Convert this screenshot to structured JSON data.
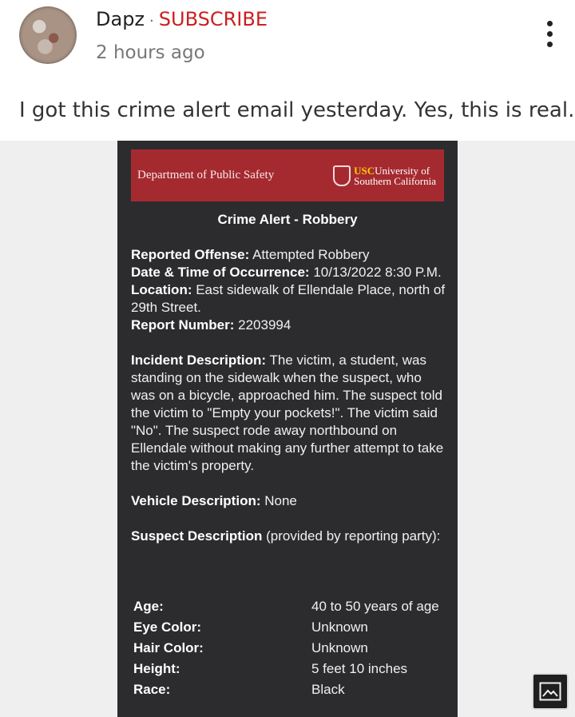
{
  "post": {
    "author": "Dapz",
    "separator": "·",
    "subscribe_label": "SUBSCRIBE",
    "timestamp": "2 hours ago",
    "text": "I got this crime alert email yesterday. Yes, this is real."
  },
  "email": {
    "banner_title": "Department of Public Safety",
    "logo_usc": "USC",
    "logo_line1": "University of",
    "logo_line2": "Southern California",
    "alert_title": "Crime Alert - Robbery",
    "fields": {
      "offense_label": "Reported Offense:",
      "offense_value": " Attempted Robbery",
      "datetime_label": "Date & Time of Occurrence:",
      "datetime_value": " 10/13/2022 8:30 P.M.",
      "location_label": "Location:",
      "location_value": " East sidewalk of Ellendale Place, north of 29th Street.",
      "report_label": "Report Number:",
      "report_value": " 2203994"
    },
    "incident_label": "Incident Description:",
    "incident_value": " The victim, a student, was standing on the sidewalk when the suspect, who was on a bicycle, approached him. The suspect told the victim to \"Empty your pockets!\". The victim said \"No\". The suspect rode away northbound on Ellendale without making any further attempt to take the victim's property.",
    "vehicle_label": "Vehicle Description:",
    "vehicle_value": " None",
    "suspect_label": "Suspect Description",
    "suspect_value": " (provided by reporting party):",
    "suspect_rows": [
      {
        "key": "Age:",
        "value": "40 to 50 years of age"
      },
      {
        "key": "Eye Color:",
        "value": "Unknown"
      },
      {
        "key": "Hair Color:",
        "value": "Unknown"
      },
      {
        "key": "Height:",
        "value": "5 feet 10 inches"
      },
      {
        "key": "Race:",
        "value": "Black"
      }
    ]
  },
  "icons": {
    "menu": "kebab-menu-icon",
    "gallery": "image-gallery-icon"
  },
  "colors": {
    "subscribe": "#cc1f1f",
    "banner": "#a52a30",
    "email_bg": "#2c2c2e"
  }
}
